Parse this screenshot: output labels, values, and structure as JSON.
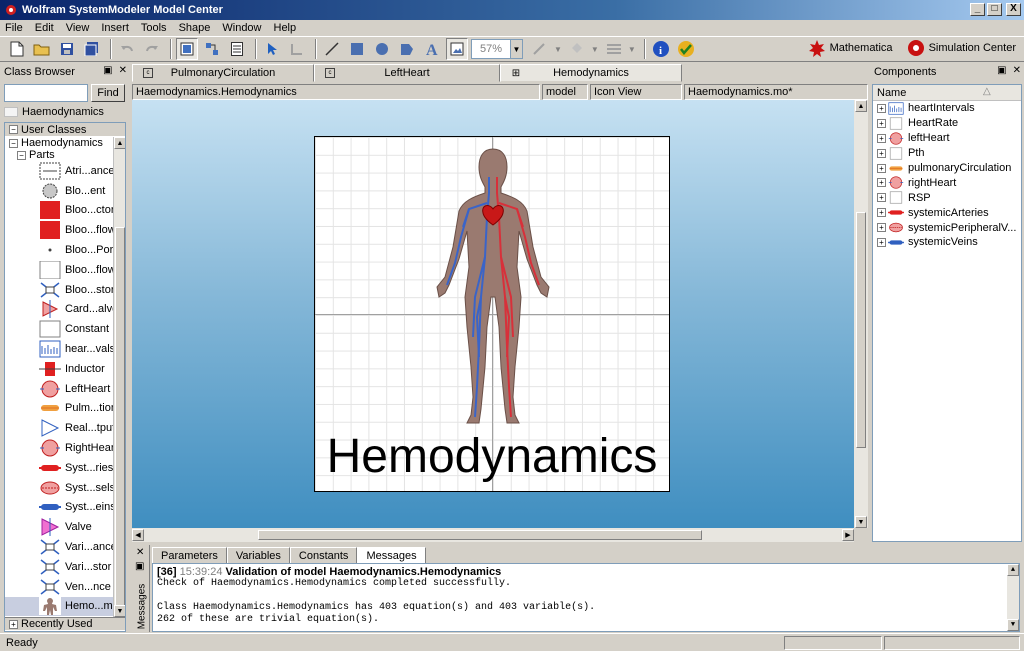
{
  "window": {
    "title": "Wolfram SystemModeler Model Center",
    "min": "_",
    "max": "□",
    "close": "X"
  },
  "menu": [
    "File",
    "Edit",
    "View",
    "Insert",
    "Tools",
    "Shape",
    "Window",
    "Help"
  ],
  "toolbar": {
    "zoom": "57%",
    "mathematica_label": "Mathematica",
    "simulation_center_label": "Simulation Center"
  },
  "class_browser": {
    "title": "Class Browser",
    "find_label": "Find",
    "find_value": "",
    "selected_model": "Haemodynamics",
    "user_classes_label": "User Classes",
    "root_package": "Haemodynamics",
    "parts_label": "Parts",
    "recently_used_label": "Recently Used",
    "parts": [
      {
        "label": "Atri...ance",
        "icon": "attrition-resistance-icon"
      },
      {
        "label": "Blo...ent",
        "icon": "blood-element-icon"
      },
      {
        "label": "Bloo...ctor",
        "icon": "blood-connector-icon"
      },
      {
        "label": "Bloo...flow",
        "icon": "blood-flow-icon"
      },
      {
        "label": "Bloo...Port",
        "icon": "blood-port-icon"
      },
      {
        "label": "Bloo...flow",
        "icon": "blood-outflow-icon"
      },
      {
        "label": "Bloo...stor",
        "icon": "blood-resistor-icon"
      },
      {
        "label": "Card...alve",
        "icon": "cardiac-valve-icon"
      },
      {
        "label": "Constant",
        "icon": "constant-icon"
      },
      {
        "label": "hear...vals",
        "icon": "heart-intervals-icon"
      },
      {
        "label": "Inductor",
        "icon": "inductor-icon"
      },
      {
        "label": "LeftHeart",
        "icon": "left-heart-icon"
      },
      {
        "label": "Pulm...tion",
        "icon": "pulmonary-circulation-icon"
      },
      {
        "label": "Real...tput",
        "icon": "real-output-icon"
      },
      {
        "label": "RightHeart",
        "icon": "right-heart-icon"
      },
      {
        "label": "Syst...ries",
        "icon": "systemic-arteries-icon"
      },
      {
        "label": "Syst...sels",
        "icon": "systemic-vessels-icon"
      },
      {
        "label": "Syst...eins",
        "icon": "systemic-veins-icon"
      },
      {
        "label": "Valve",
        "icon": "valve-icon"
      },
      {
        "label": "Vari...ance",
        "icon": "variable-capacitance-icon"
      },
      {
        "label": "Vari...stor",
        "icon": "variable-resistor-icon"
      },
      {
        "label": "Ven...nce",
        "icon": "venous-compliance-icon"
      },
      {
        "label": "Hemo...mics",
        "icon": "hemodynamics-icon"
      }
    ]
  },
  "tabs": [
    {
      "label": "PulmonaryCirculation"
    },
    {
      "label": "LeftHeart"
    },
    {
      "label": "Hemodynamics"
    }
  ],
  "pathbar": {
    "path": "Haemodynamics.Hemodynamics",
    "kind": "model",
    "view": "Icon View",
    "file": "Haemodynamics.mo*"
  },
  "diagram": {
    "title": "Hemodynamics"
  },
  "components": {
    "title": "Components",
    "column": "Name",
    "items": [
      {
        "label": "heartIntervals",
        "icon": "heart-intervals-icon"
      },
      {
        "label": "HeartRate",
        "icon": "blank-icon"
      },
      {
        "label": "leftHeart",
        "icon": "left-heart-icon"
      },
      {
        "label": "Pth",
        "icon": "blank-icon"
      },
      {
        "label": "pulmonaryCirculation",
        "icon": "pulmonary-circulation-icon"
      },
      {
        "label": "rightHeart",
        "icon": "right-heart-icon"
      },
      {
        "label": "RSP",
        "icon": "blank-icon"
      },
      {
        "label": "systemicArteries",
        "icon": "systemic-arteries-icon"
      },
      {
        "label": "systemicPeripheralV...",
        "icon": "systemic-vessels-icon"
      },
      {
        "label": "systemicVeins",
        "icon": "systemic-veins-icon"
      }
    ]
  },
  "messages": {
    "side_label": "Messages",
    "tabs": [
      "Parameters",
      "Variables",
      "Constants",
      "Messages"
    ],
    "header_id": "[36]",
    "header_time": "15:39:24",
    "header_text": "Validation of model Haemodynamics.Hemodynamics",
    "lines": [
      "Check of Haemodynamics.Hemodynamics completed successfully.",
      "",
      "Class Haemodynamics.Hemodynamics has 403 equation(s) and 403 variable(s).",
      "262 of these are trivial equation(s)."
    ]
  },
  "status": {
    "text": "Ready"
  },
  "colors": {
    "artery_red": "#d8303a",
    "vein_blue": "#3a64c8",
    "body_brown": "#9a7a70"
  }
}
